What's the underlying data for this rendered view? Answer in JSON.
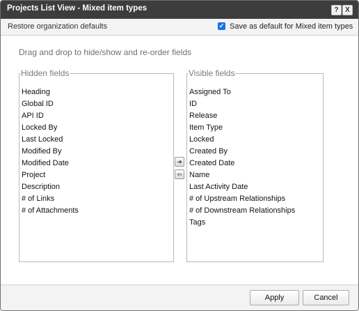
{
  "dialog": {
    "title": "Projects List View - Mixed item types",
    "help_glyph": "?",
    "close_glyph": "X",
    "icons": {
      "help": "help-icon",
      "close": "close-icon"
    }
  },
  "options": {
    "restore_label": "Restore organization defaults",
    "save_default_label": "Save as default for Mixed item types",
    "save_default_checked": true,
    "checkmark": "✓"
  },
  "instruction": "Drag and drop to hide/show and re-order fields",
  "hidden_fields": {
    "legend": "Hidden fields",
    "items": [
      "Heading",
      "Global ID",
      "API ID",
      "Locked By",
      "Last Locked",
      "Modified By",
      "Modified Date",
      "Project",
      "Description",
      "# of Links",
      "# of Attachments"
    ]
  },
  "visible_fields": {
    "legend": "Visible fields",
    "items": [
      "Assigned To",
      "ID",
      "Release",
      "Item Type",
      "Locked",
      "Created By",
      "Created Date",
      "Name",
      "Last Activity Date",
      "# of Upstream Relationships",
      "# of Downstream Relationships",
      "Tags"
    ]
  },
  "move_buttons": {
    "right_glyph": "➔",
    "left_glyph": "⇦",
    "icons": {
      "right": "arrow-right-icon",
      "left": "arrow-left-icon"
    }
  },
  "footer": {
    "apply_label": "Apply",
    "cancel_label": "Cancel"
  },
  "colors": {
    "titlebar": "#3d3d3d",
    "checkbox_accent": "#1a73e8"
  }
}
